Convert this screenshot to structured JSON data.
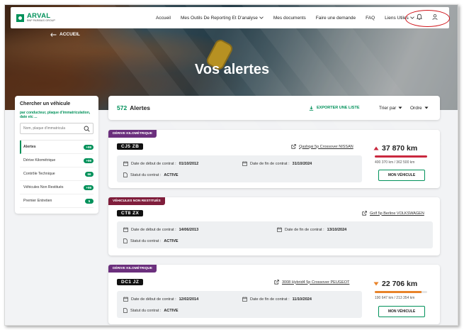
{
  "nav": {
    "logo_name": "ARVAL",
    "logo_sub": "BNP PARIBAS GROUP",
    "items": [
      {
        "label": "Accueil",
        "chevron": false
      },
      {
        "label": "Mes Outils De Reporting Et D'analyse",
        "chevron": true
      },
      {
        "label": "Mes documents",
        "chevron": false
      },
      {
        "label": "Faire une demande",
        "chevron": false
      },
      {
        "label": "FAQ",
        "chevron": false
      },
      {
        "label": "Liens Utiles",
        "chevron": true
      }
    ],
    "icons": [
      "bell-icon",
      "user-icon"
    ]
  },
  "hero": {
    "back_label": "ACCUEIL",
    "title": "Vos alertes"
  },
  "sidebar": {
    "title": "Chercher un véhicule",
    "hint": "par conducteur, plaque d'immatriculation, date etc ...",
    "search_placeholder": "Nom, plaque d'immatricula",
    "items": [
      {
        "label": "Alertes",
        "badge": "+99",
        "active": true
      },
      {
        "label": "Dérive Kilométrique",
        "badge": "+99",
        "active": false
      },
      {
        "label": "Contrôle Technique",
        "badge": "66",
        "active": false
      },
      {
        "label": "Véhicules Non Restitués",
        "badge": "+99",
        "active": false
      },
      {
        "label": "Premier Entretien",
        "badge": "5",
        "active": false
      }
    ]
  },
  "main": {
    "count": "572",
    "count_label": "Alertes",
    "export_label": "EXPORTER UNE LISTE",
    "sort_label": "Trier par",
    "order_label": "Ordre",
    "cards": [
      {
        "tag": "DÉRIVE KILOMÉTRIQUE",
        "plate": "CJ5  ZB",
        "vehicle": "Qashqai 5p Crossover NISSAN",
        "start_label": "Date de début de contrat :",
        "start": "01/10/2012",
        "end_label": "Date de fin de contrat :",
        "end": "31/10/2024",
        "status_label": "Statut du contrat :",
        "status": "ACTIVE",
        "km": "37 870 km",
        "km_detail": "400 370 km / 362 500 km",
        "km_ratio": 1.0,
        "km_color": "#c9283e",
        "button": "MON VÉHICULE"
      },
      {
        "tag": "VÉHICULES NON RESTITUÉS",
        "plate": "CT8  ZX",
        "vehicle": "Golf 5p Berline VOLKSWAGEN",
        "start_label": "Date de début de contrat :",
        "start": "14/06/2013",
        "end_label": "Date de fin de contrat :",
        "end": "13/10/2024",
        "status_label": "Statut du contrat :",
        "status": "ACTIVE"
      },
      {
        "tag": "DÉRIVE KILOMÉTRIQUE",
        "plate": "DC1  JZ",
        "vehicle": "3008 Hybrid4 5p Crossover PEUGEOT",
        "start_label": "Date de début de contrat :",
        "start": "12/02/2014",
        "end_label": "Date de fin de contrat :",
        "end": "11/10/2024",
        "status_label": "Statut du contrat :",
        "status": "ACTIVE",
        "km": "22 706 km",
        "km_detail": "190 647 km / 213 354 km",
        "km_ratio": 0.89,
        "km_color": "#e8832a",
        "button": "MON VÉHICULE"
      }
    ]
  },
  "colors": {
    "brand": "#00915a",
    "tag_purple": "#6b2f7d",
    "tag_maroon": "#7f1d3b",
    "highlight_oval": "#d0151b"
  }
}
